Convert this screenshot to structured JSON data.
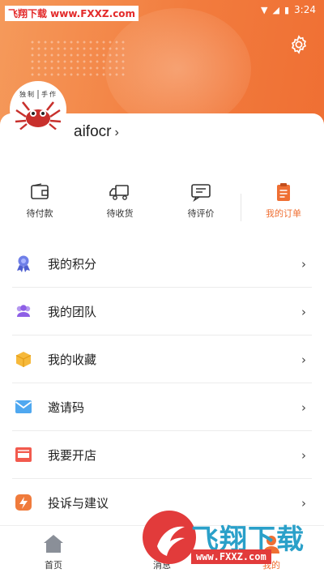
{
  "watermark_top": "飞翔下载 www.FXXZ.com",
  "status_bar": {
    "time": "3:24"
  },
  "profile": {
    "username": "aifocr",
    "chevron": "›",
    "avatar_text": [
      "独",
      "制",
      "手",
      "作"
    ]
  },
  "orders": [
    {
      "label": "待付款",
      "icon": "wallet-icon"
    },
    {
      "label": "待收货",
      "icon": "truck-icon"
    },
    {
      "label": "待评价",
      "icon": "comment-icon"
    },
    {
      "label": "我的订单",
      "icon": "clipboard-icon"
    }
  ],
  "menu": [
    {
      "label": "我的积分",
      "icon": "medal-icon"
    },
    {
      "label": "我的团队",
      "icon": "team-icon"
    },
    {
      "label": "我的收藏",
      "icon": "box-icon"
    },
    {
      "label": "邀请码",
      "icon": "envelope-icon"
    },
    {
      "label": "我要开店",
      "icon": "store-icon"
    },
    {
      "label": "投诉与建议",
      "icon": "lightning-icon"
    }
  ],
  "tabs": [
    {
      "label": "首页",
      "icon": "home-icon"
    },
    {
      "label": "消息",
      "icon": "message-icon"
    },
    {
      "label": "我的",
      "icon": "user-icon"
    }
  ],
  "watermark_bottom": {
    "brand": "飞翔下载",
    "url": "www.FXXZ.com"
  },
  "colors": {
    "accent": "#ef6f33",
    "header_start": "#f59a5b",
    "header_end": "#ef6f33"
  }
}
